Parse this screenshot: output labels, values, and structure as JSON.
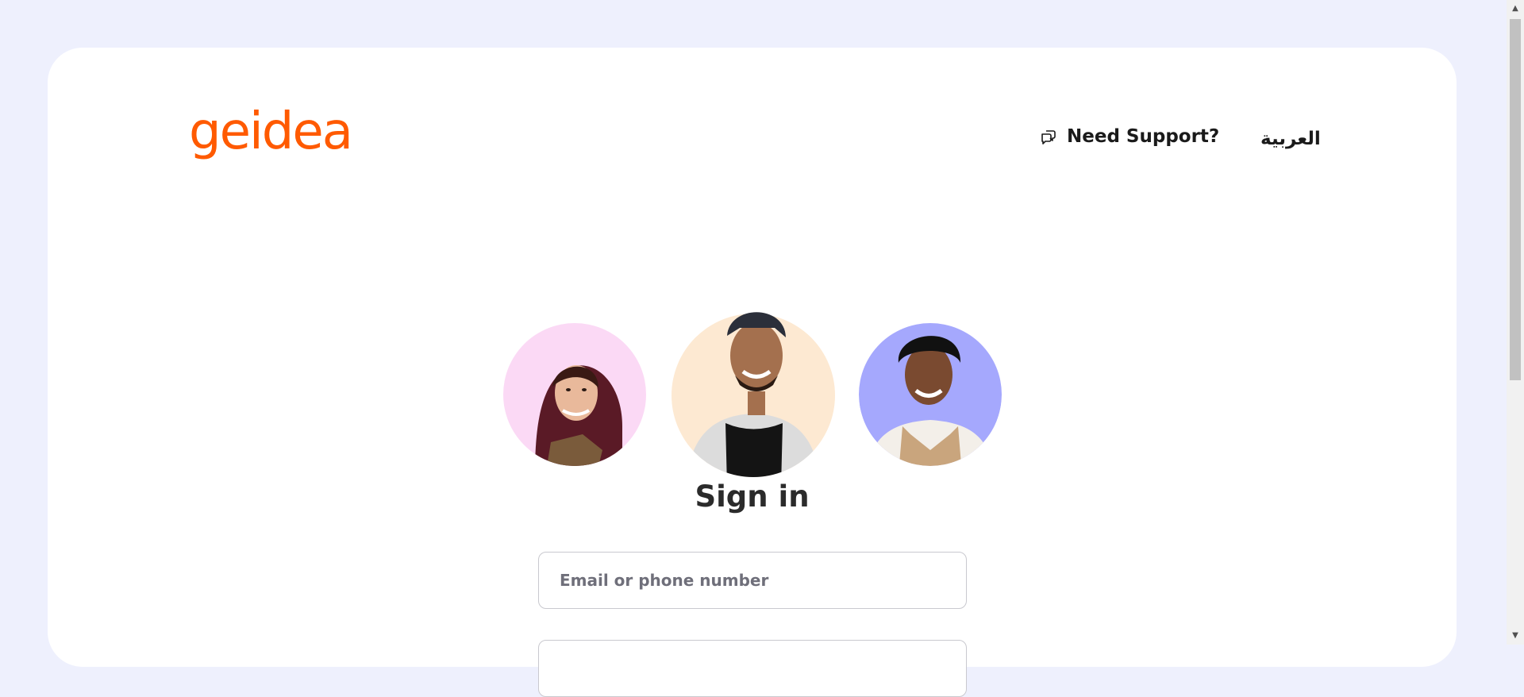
{
  "brand": {
    "logo_text": "geidea",
    "accent_color": "#ff5a00"
  },
  "header": {
    "support_label": "Need Support?",
    "support_icon": "chat-bubbles-icon",
    "language_label": "العربية"
  },
  "avatars": [
    {
      "name": "avatar-woman",
      "bg": "#fbd9f5"
    },
    {
      "name": "avatar-man-cap",
      "bg": "#fde9d2"
    },
    {
      "name": "avatar-man-apron",
      "bg": "#a5a8fd"
    }
  ],
  "form": {
    "title": "Sign in",
    "email_placeholder": "Email or phone number"
  }
}
